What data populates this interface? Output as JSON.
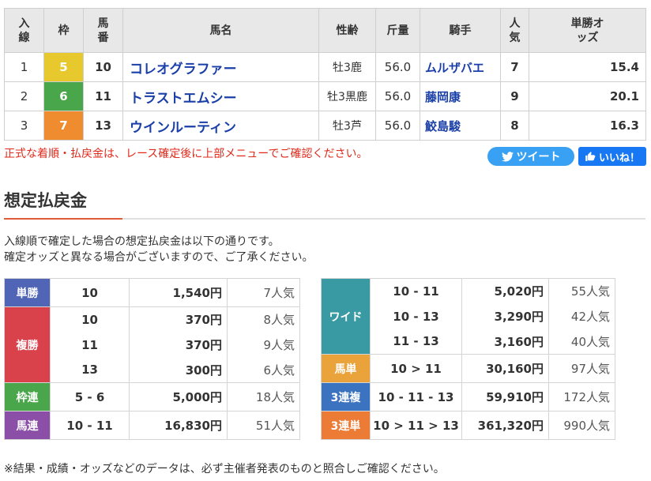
{
  "result": {
    "headers": {
      "finish": "入線",
      "frame": "枠",
      "number": "馬番",
      "horse": "馬名",
      "sex_age": "性齢",
      "weight": "斤量",
      "jockey": "騎手",
      "popularity": "人気",
      "odds": "単勝オッズ"
    },
    "rows": [
      {
        "finish": "1",
        "frame": "5",
        "number": "10",
        "horse": "コレオグラファー",
        "sex_age": "牡3鹿",
        "weight": "56.0",
        "jockey": "ムルザバエ",
        "popularity": "7",
        "odds": "15.4",
        "frame_color": "#e7c92d"
      },
      {
        "finish": "2",
        "frame": "6",
        "number": "11",
        "horse": "トラストエムシー",
        "sex_age": "牡3黒鹿",
        "weight": "56.0",
        "jockey": "藤岡康",
        "popularity": "9",
        "odds": "20.1",
        "frame_color": "#4aa64a"
      },
      {
        "finish": "3",
        "frame": "7",
        "number": "13",
        "horse": "ウインルーティン",
        "sex_age": "牡3芦",
        "weight": "56.0",
        "jockey": "鮫島駿",
        "popularity": "8",
        "odds": "16.3",
        "frame_color": "#ef8c2f"
      }
    ]
  },
  "notice": "正式な着順・払戻金は、レース確定後に上部メニューでご確認ください。",
  "share": {
    "tweet_label": "ツイート",
    "like_label": "いいね！"
  },
  "payout": {
    "title": "想定払戻金",
    "desc_line1": "入線順で確定した場合の想定払戻金は以下の通りです。",
    "desc_line2": "確定オッズと異なる場合がございますので、ご了承ください。",
    "tansho": {
      "label": "単勝",
      "rows": [
        {
          "combo": "10",
          "amount": "1,540円",
          "pop": "7人気"
        }
      ]
    },
    "fukusho": {
      "label": "複勝",
      "rows": [
        {
          "combo": "10",
          "amount": "370円",
          "pop": "8人気"
        },
        {
          "combo": "11",
          "amount": "370円",
          "pop": "9人気"
        },
        {
          "combo": "13",
          "amount": "300円",
          "pop": "6人気"
        }
      ]
    },
    "wakuren": {
      "label": "枠連",
      "rows": [
        {
          "combo": "5 - 6",
          "amount": "5,000円",
          "pop": "18人気"
        }
      ]
    },
    "umaren": {
      "label": "馬連",
      "rows": [
        {
          "combo": "10 - 11",
          "amount": "16,830円",
          "pop": "51人気"
        }
      ]
    },
    "wide": {
      "label": "ワイド",
      "rows": [
        {
          "combo": "10 - 11",
          "amount": "5,020円",
          "pop": "55人気"
        },
        {
          "combo": "10 - 13",
          "amount": "3,290円",
          "pop": "42人気"
        },
        {
          "combo": "11 - 13",
          "amount": "3,160円",
          "pop": "40人気"
        }
      ]
    },
    "umatan": {
      "label": "馬単",
      "rows": [
        {
          "combo": "10 > 11",
          "amount": "30,160円",
          "pop": "97人気"
        }
      ]
    },
    "sanrenpuku": {
      "label": "3連複",
      "rows": [
        {
          "combo": "10 - 11 - 13",
          "amount": "59,910円",
          "pop": "172人気"
        }
      ]
    },
    "sanrentan": {
      "label": "3連単",
      "rows": [
        {
          "combo": "10 > 11 > 13",
          "amount": "361,320円",
          "pop": "990人気"
        }
      ]
    }
  },
  "footnote": "※結果・成績・オッズなどのデータは、必ず主催者発表のものと照合しご確認ください。"
}
